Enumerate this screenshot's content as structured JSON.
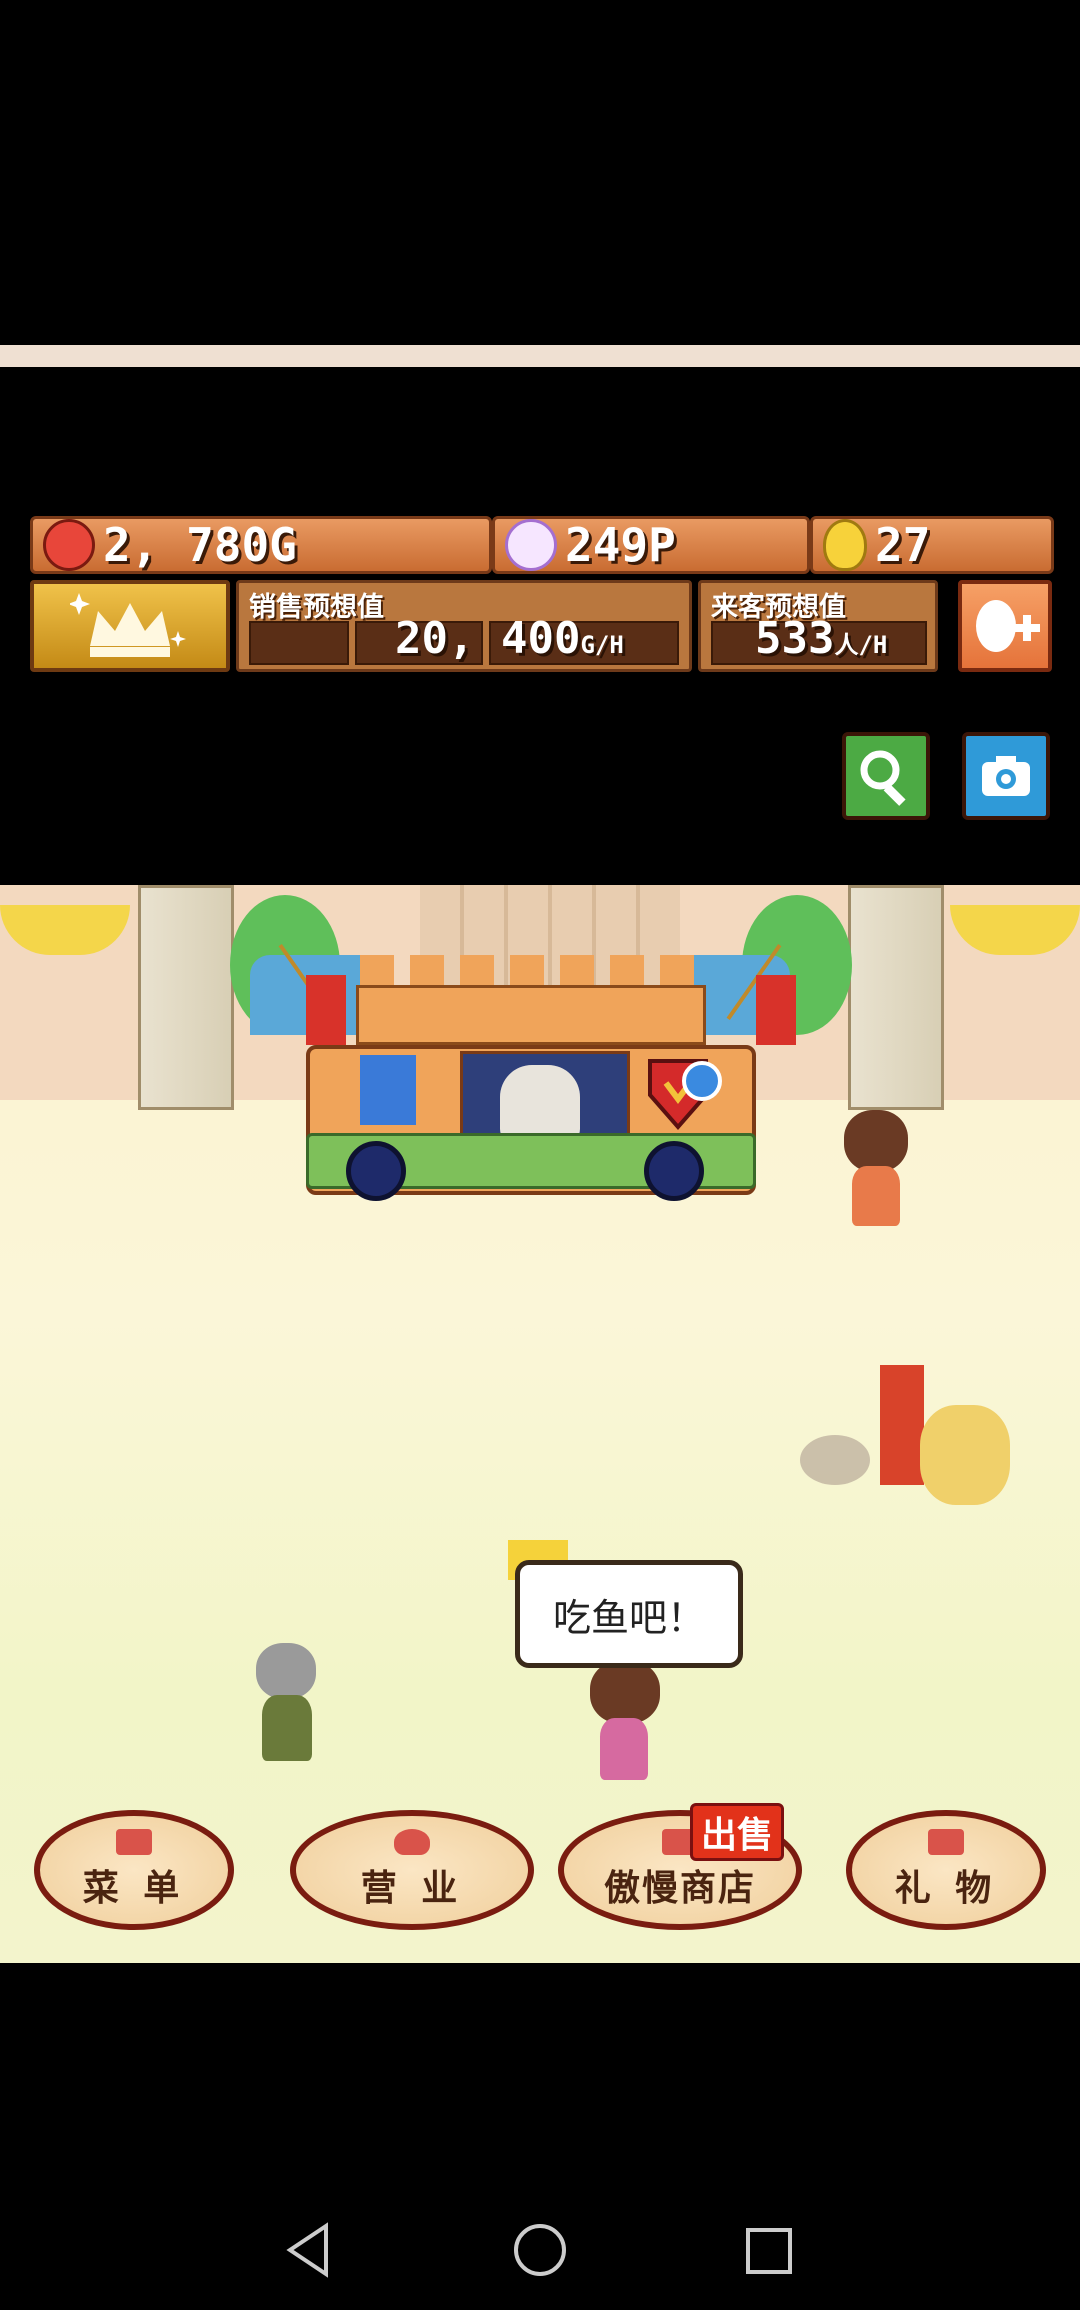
{
  "hud": {
    "gold": "2, 780G",
    "points": "249P",
    "eggs": "27",
    "sales_label": "销售预想值",
    "sales_value": "20, 400",
    "sales_unit": "G/H",
    "visitors_label": "来客预想值",
    "visitors_value": "533",
    "visitors_unit": "人/H"
  },
  "speech": "吃鱼吧！",
  "menu": {
    "recipe": "菜 单",
    "business": "营 业",
    "shop": "傲慢商店",
    "shop_badge": "出售",
    "gift": "礼 物"
  },
  "colors": {
    "accent_gold": "#e0a82a",
    "button_border": "#7a1c10",
    "badge_red": "#e2321a"
  }
}
